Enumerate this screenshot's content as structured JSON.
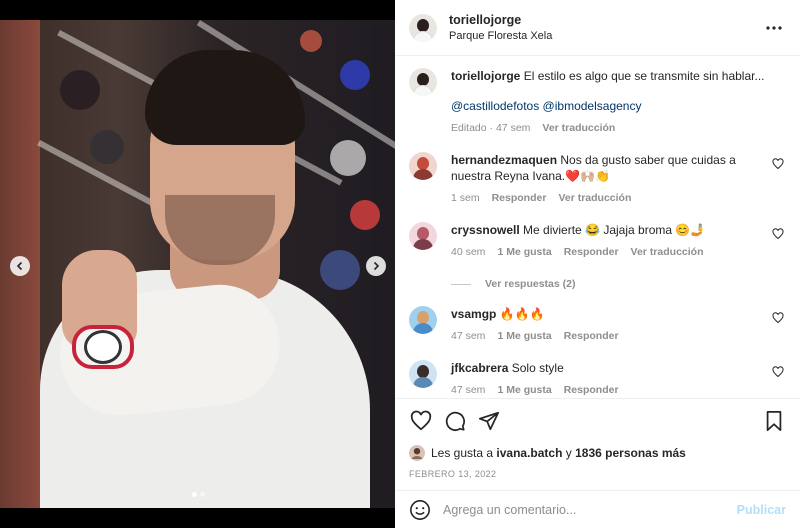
{
  "post": {
    "author": "toriellojorge",
    "location": "Parque Floresta Xela"
  },
  "caption": {
    "author": "toriellojorge",
    "text": "El estilo es algo que se transmite sin hablar...",
    "mentions": "@castillodefotos @ibmodelsagency",
    "edited": "Editado",
    "time": "47 sem",
    "translate": "Ver traducción"
  },
  "comments": [
    {
      "author": "hernandezmaquen",
      "text": "Nos da gusto saber que cuidas a nuestra Reyna Ivana.❤️🙌🏼👏",
      "time": "1 sem",
      "reply": "Responder",
      "translate": "Ver traducción",
      "avatar_color": "#c44a3c"
    },
    {
      "author": "cryssnowell",
      "text": "Me divierte 😂 Jajaja broma 😊🤳",
      "time": "40 sem",
      "likes": "1 Me gusta",
      "reply": "Responder",
      "translate": "Ver traducción",
      "avatar_color": "#b65a6a"
    },
    {
      "author": "vsamgp",
      "text": "🔥🔥🔥",
      "time": "47 sem",
      "likes": "1 Me gusta",
      "reply": "Responder",
      "avatar_color": "#4a8cc8"
    },
    {
      "author": "jfkcabrera",
      "text": "Solo style",
      "time": "47 sem",
      "likes": "1 Me gusta",
      "reply": "Responder",
      "avatar_color": "#5a8ab4"
    }
  ],
  "view_replies": "Ver respuestas (2)",
  "likes": {
    "prefix": "Les gusta a",
    "user": "ivana.batch",
    "joiner": "y",
    "others": "1836 personas más"
  },
  "date": "FEBRERO 13, 2022",
  "composer": {
    "placeholder": "Agrega un comentario...",
    "publish": "Publicar"
  },
  "carousel": {
    "dots": 2,
    "active": 1
  },
  "icons": [
    "more-icon",
    "heart-icon",
    "comment-icon",
    "share-icon",
    "bookmark-icon",
    "emoji-icon",
    "chevron-left-icon",
    "chevron-right-icon"
  ]
}
